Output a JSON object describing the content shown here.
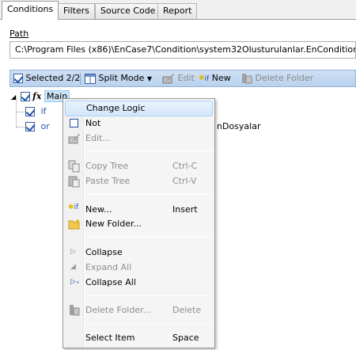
{
  "tabs": [
    {
      "label": "Conditions",
      "active": true
    },
    {
      "label": "Filters"
    },
    {
      "label": "Source Code"
    },
    {
      "label": "Report"
    }
  ],
  "path": {
    "label": "Path",
    "value": "C:\\Program Files (x86)\\EnCase7\\Condition\\system32Olusturulanlar.EnCondition"
  },
  "toolbar": {
    "selected": "Selected 2/2",
    "split_mode": "Split Mode",
    "edit": "Edit",
    "new": "New",
    "new_prefix": "if",
    "delete_folder": "Delete Folder"
  },
  "tree": {
    "root_label": "Main",
    "child1_label": "if",
    "child2_label": "or",
    "child2_tail": "nDosyalar"
  },
  "menu": {
    "change_logic": "Change Logic",
    "not": "Not",
    "edit": "Edit...",
    "copy_tree": "Copy Tree",
    "copy_tree_key": "Ctrl-C",
    "paste_tree": "Paste Tree",
    "paste_tree_key": "Ctrl-V",
    "new": "New...",
    "new_key": "Insert",
    "new_folder": "New Folder...",
    "collapse": "Collapse",
    "expand_all": "Expand All",
    "collapse_all": "Collapse All",
    "delete_folder": "Delete Folder...",
    "delete_folder_key": "Delete",
    "select_item": "Select Item",
    "select_item_key": "Space"
  },
  "colors": {
    "toolbar_bg": "#c4d8f0",
    "menu_hover": "#d3e6fa",
    "disabled_text": "#8d8d8d"
  }
}
